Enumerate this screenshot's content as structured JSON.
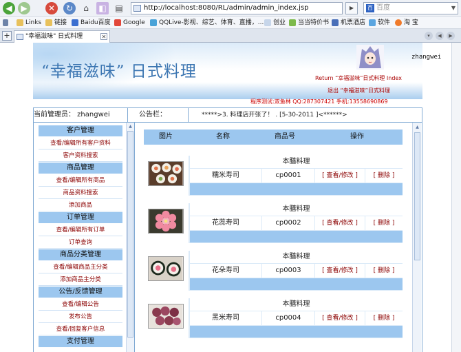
{
  "browser": {
    "url": "http://localhost:8080/RL/admin/admin_index.jsp",
    "search_placeholder": "百度",
    "bookmarks": [
      "Links",
      "链接",
      "Baidu百度",
      "Google",
      "QQLive-影视、综艺、体育、直播，...",
      "创业",
      "当当特价书",
      "机票酒店",
      "软件",
      "淘 宝"
    ],
    "tab_title": "\"幸福滋味\" 日式料理"
  },
  "header": {
    "title": "“幸福滋味” 日式料理",
    "admin_name": "zhangwei",
    "return_link": "Return “幸福滋味”日式料理 Index",
    "logout_link": "退出 “幸福滋味”日式料理",
    "contact": "程序测试:双鱼林 QQ:287307421 手机:13558690869"
  },
  "infobar": {
    "manager_label": "当前管理员： zhangwei",
    "notice_label": "公告栏：",
    "notice_text": "*****>3. 料理店开张了！ . [5-30-2011 ]<******>"
  },
  "sidebar": {
    "groups": [
      {
        "title": "客户管理",
        "items": [
          "查看/编辑所有客户资料",
          "客户资料搜索"
        ]
      },
      {
        "title": "商品管理",
        "items": [
          "查看/编辑所有商品",
          "商品资料搜索",
          "添加商品"
        ]
      },
      {
        "title": "订单管理",
        "items": [
          "查看/编辑所有订单",
          "订单查询"
        ]
      },
      {
        "title": "商品分类管理",
        "items": [
          "查看/编辑商品主分类",
          "添加商品主分类"
        ]
      },
      {
        "title": "公告/反馈管理",
        "items": [
          "查看/编辑公告",
          "发布公告",
          "查看/回复客户信息"
        ]
      },
      {
        "title": "支付管理",
        "items": []
      }
    ]
  },
  "table": {
    "headers": [
      "图片",
      "名称",
      "商品号",
      "操作"
    ],
    "rows": [
      {
        "category": "本膳料理",
        "name": "糯米寿司",
        "code": "cp0001",
        "view": "[ 查看/修改 ]",
        "del": "[ 删除 ]"
      },
      {
        "category": "本膳料理",
        "name": "花蕊寿司",
        "code": "cp0002",
        "view": "[ 查看/修改 ]",
        "del": "[ 删除 ]"
      },
      {
        "category": "本膳料理",
        "name": "花朵寿司",
        "code": "cp0003",
        "view": "[ 查看/修改 ]",
        "del": "[ 删除 ]"
      },
      {
        "category": "本膳料理",
        "name": "黑米寿司",
        "code": "cp0004",
        "view": "[ 查看/修改 ]",
        "del": "[ 删除 ]"
      }
    ]
  },
  "colors": {
    "accent": "#9cc7ef",
    "link": "#8b0000",
    "title": "#3c76b2",
    "contact": "#cc0000"
  }
}
